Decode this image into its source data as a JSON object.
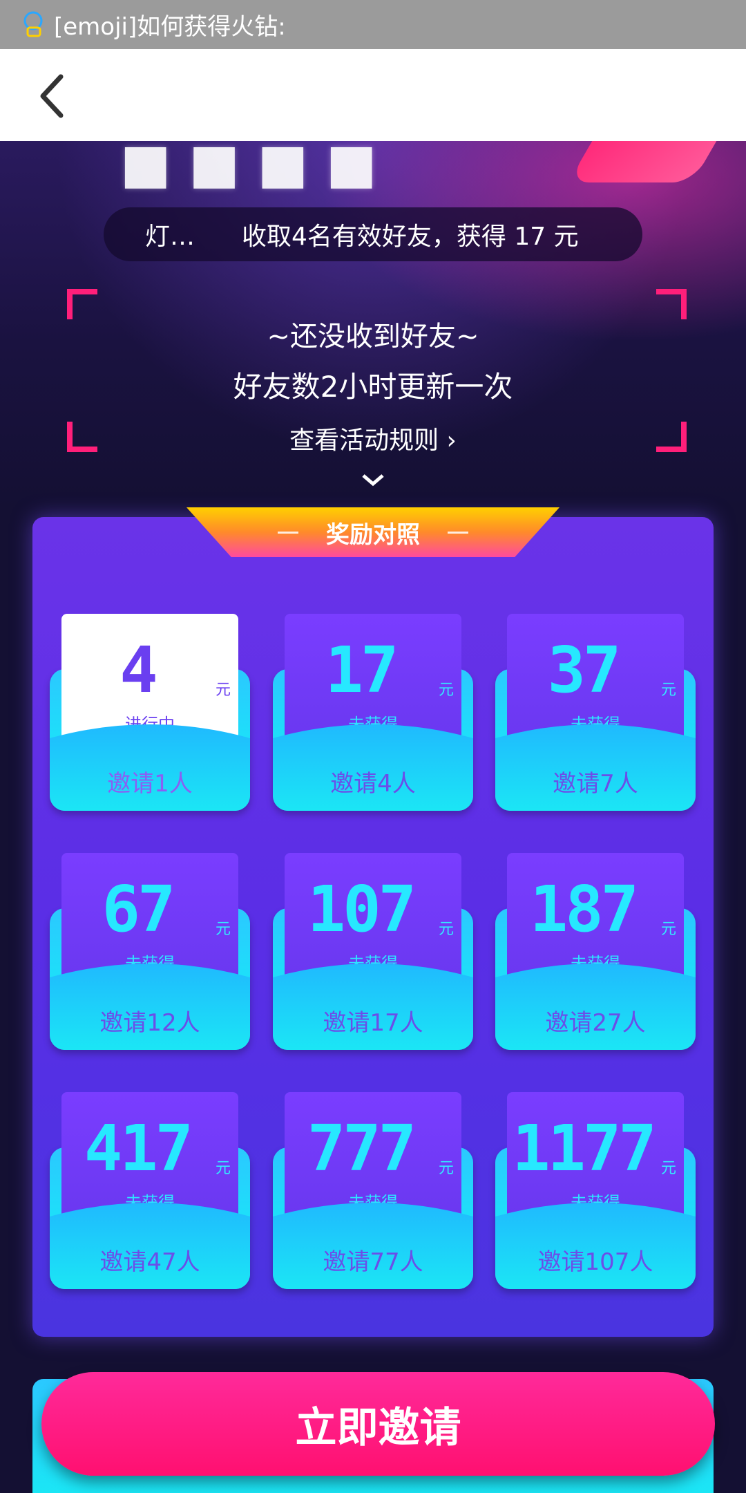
{
  "status_bar": {
    "notification_text": "[emoji]如何获得火钻:"
  },
  "hero": {
    "marquee_lead": "灯…",
    "marquee_message": "收取4名有效好友，获得 17 元",
    "friends_empty": "~还没收到好友~",
    "refresh_note": "好友数2小时更新一次",
    "rules_link": "查看活动规则 ›"
  },
  "rewards": {
    "tab_title": "奖励对照",
    "cards": [
      {
        "amount": "4",
        "unit": "元",
        "status": "进行中",
        "invite": "邀请1人",
        "active": true
      },
      {
        "amount": "17",
        "unit": "元",
        "status": "未获得",
        "invite": "邀请4人",
        "active": false
      },
      {
        "amount": "37",
        "unit": "元",
        "status": "未获得",
        "invite": "邀请7人",
        "active": false
      },
      {
        "amount": "67",
        "unit": "元",
        "status": "未获得",
        "invite": "邀请12人",
        "active": false
      },
      {
        "amount": "107",
        "unit": "元",
        "status": "未获得",
        "invite": "邀请17人",
        "active": false
      },
      {
        "amount": "187",
        "unit": "元",
        "status": "未获得",
        "invite": "邀请27人",
        "active": false
      },
      {
        "amount": "417",
        "unit": "元",
        "status": "未获得",
        "invite": "邀请47人",
        "active": false
      },
      {
        "amount": "777",
        "unit": "元",
        "status": "未获得",
        "invite": "邀请77人",
        "active": false
      },
      {
        "amount": "1177",
        "unit": "元",
        "status": "未获得",
        "invite": "邀请107人",
        "active": false
      }
    ]
  },
  "cta": {
    "label": "立即邀请"
  },
  "colors": {
    "accent_pink": "#ff1f7a",
    "panel_purple": "#5a2ee6",
    "cyan": "#1be6f5"
  }
}
